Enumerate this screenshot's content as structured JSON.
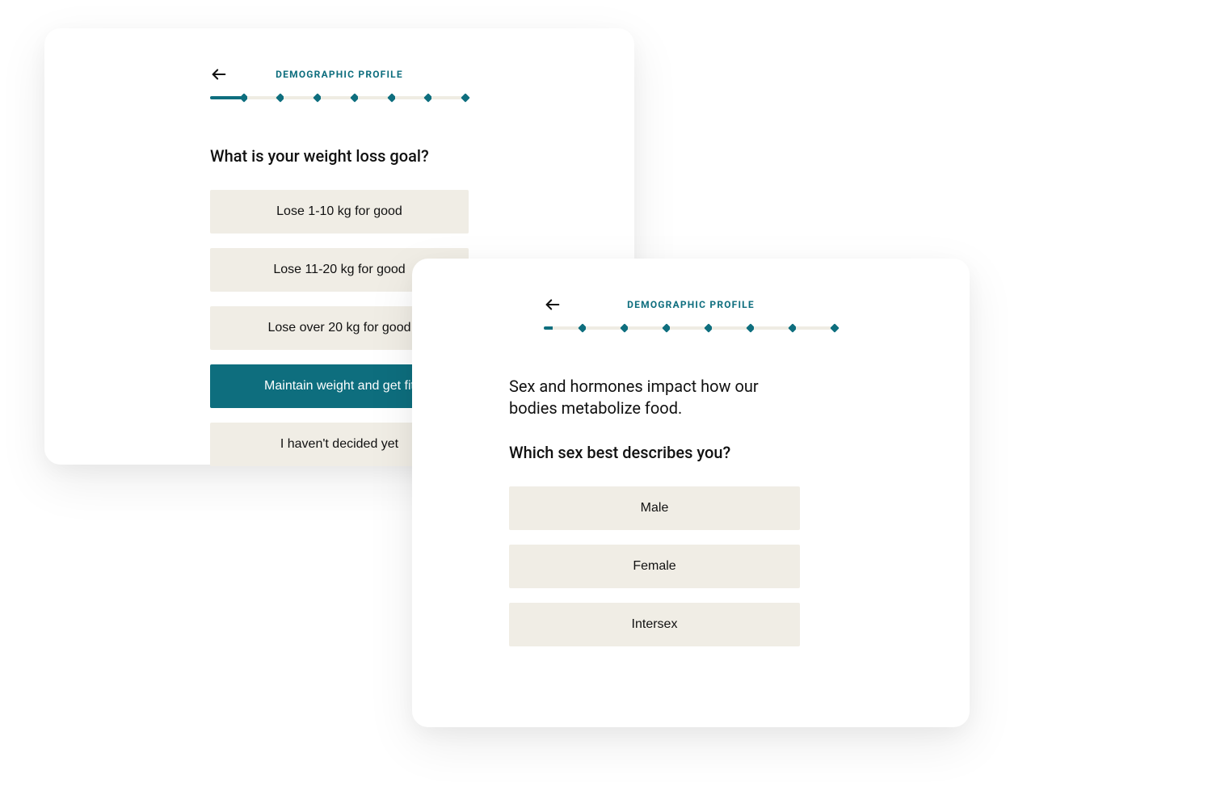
{
  "card1": {
    "headerTitle": "DEMOGRAPHIC PROFILE",
    "question": "What is your weight loss goal?",
    "options": [
      {
        "label": "Lose 1-10 kg for good",
        "selected": false
      },
      {
        "label": "Lose 11-20 kg for good",
        "selected": false
      },
      {
        "label": "Lose over 20 kg for good",
        "selected": false
      },
      {
        "label": "Maintain weight and get fit",
        "selected": true
      },
      {
        "label": "I haven't decided yet",
        "selected": false
      }
    ]
  },
  "card2": {
    "headerTitle": "DEMOGRAPHIC PROFILE",
    "introText": "Sex and hormones impact how our bodies metabolize food.",
    "question": "Which sex best describes you?",
    "options": [
      {
        "label": "Male",
        "selected": false
      },
      {
        "label": "Female",
        "selected": false
      },
      {
        "label": "Intersex",
        "selected": false
      }
    ]
  },
  "colors": {
    "primary": "#0e6e7e",
    "optionBg": "#f0ede5",
    "text": "#111111",
    "cardBg": "#ffffff"
  }
}
